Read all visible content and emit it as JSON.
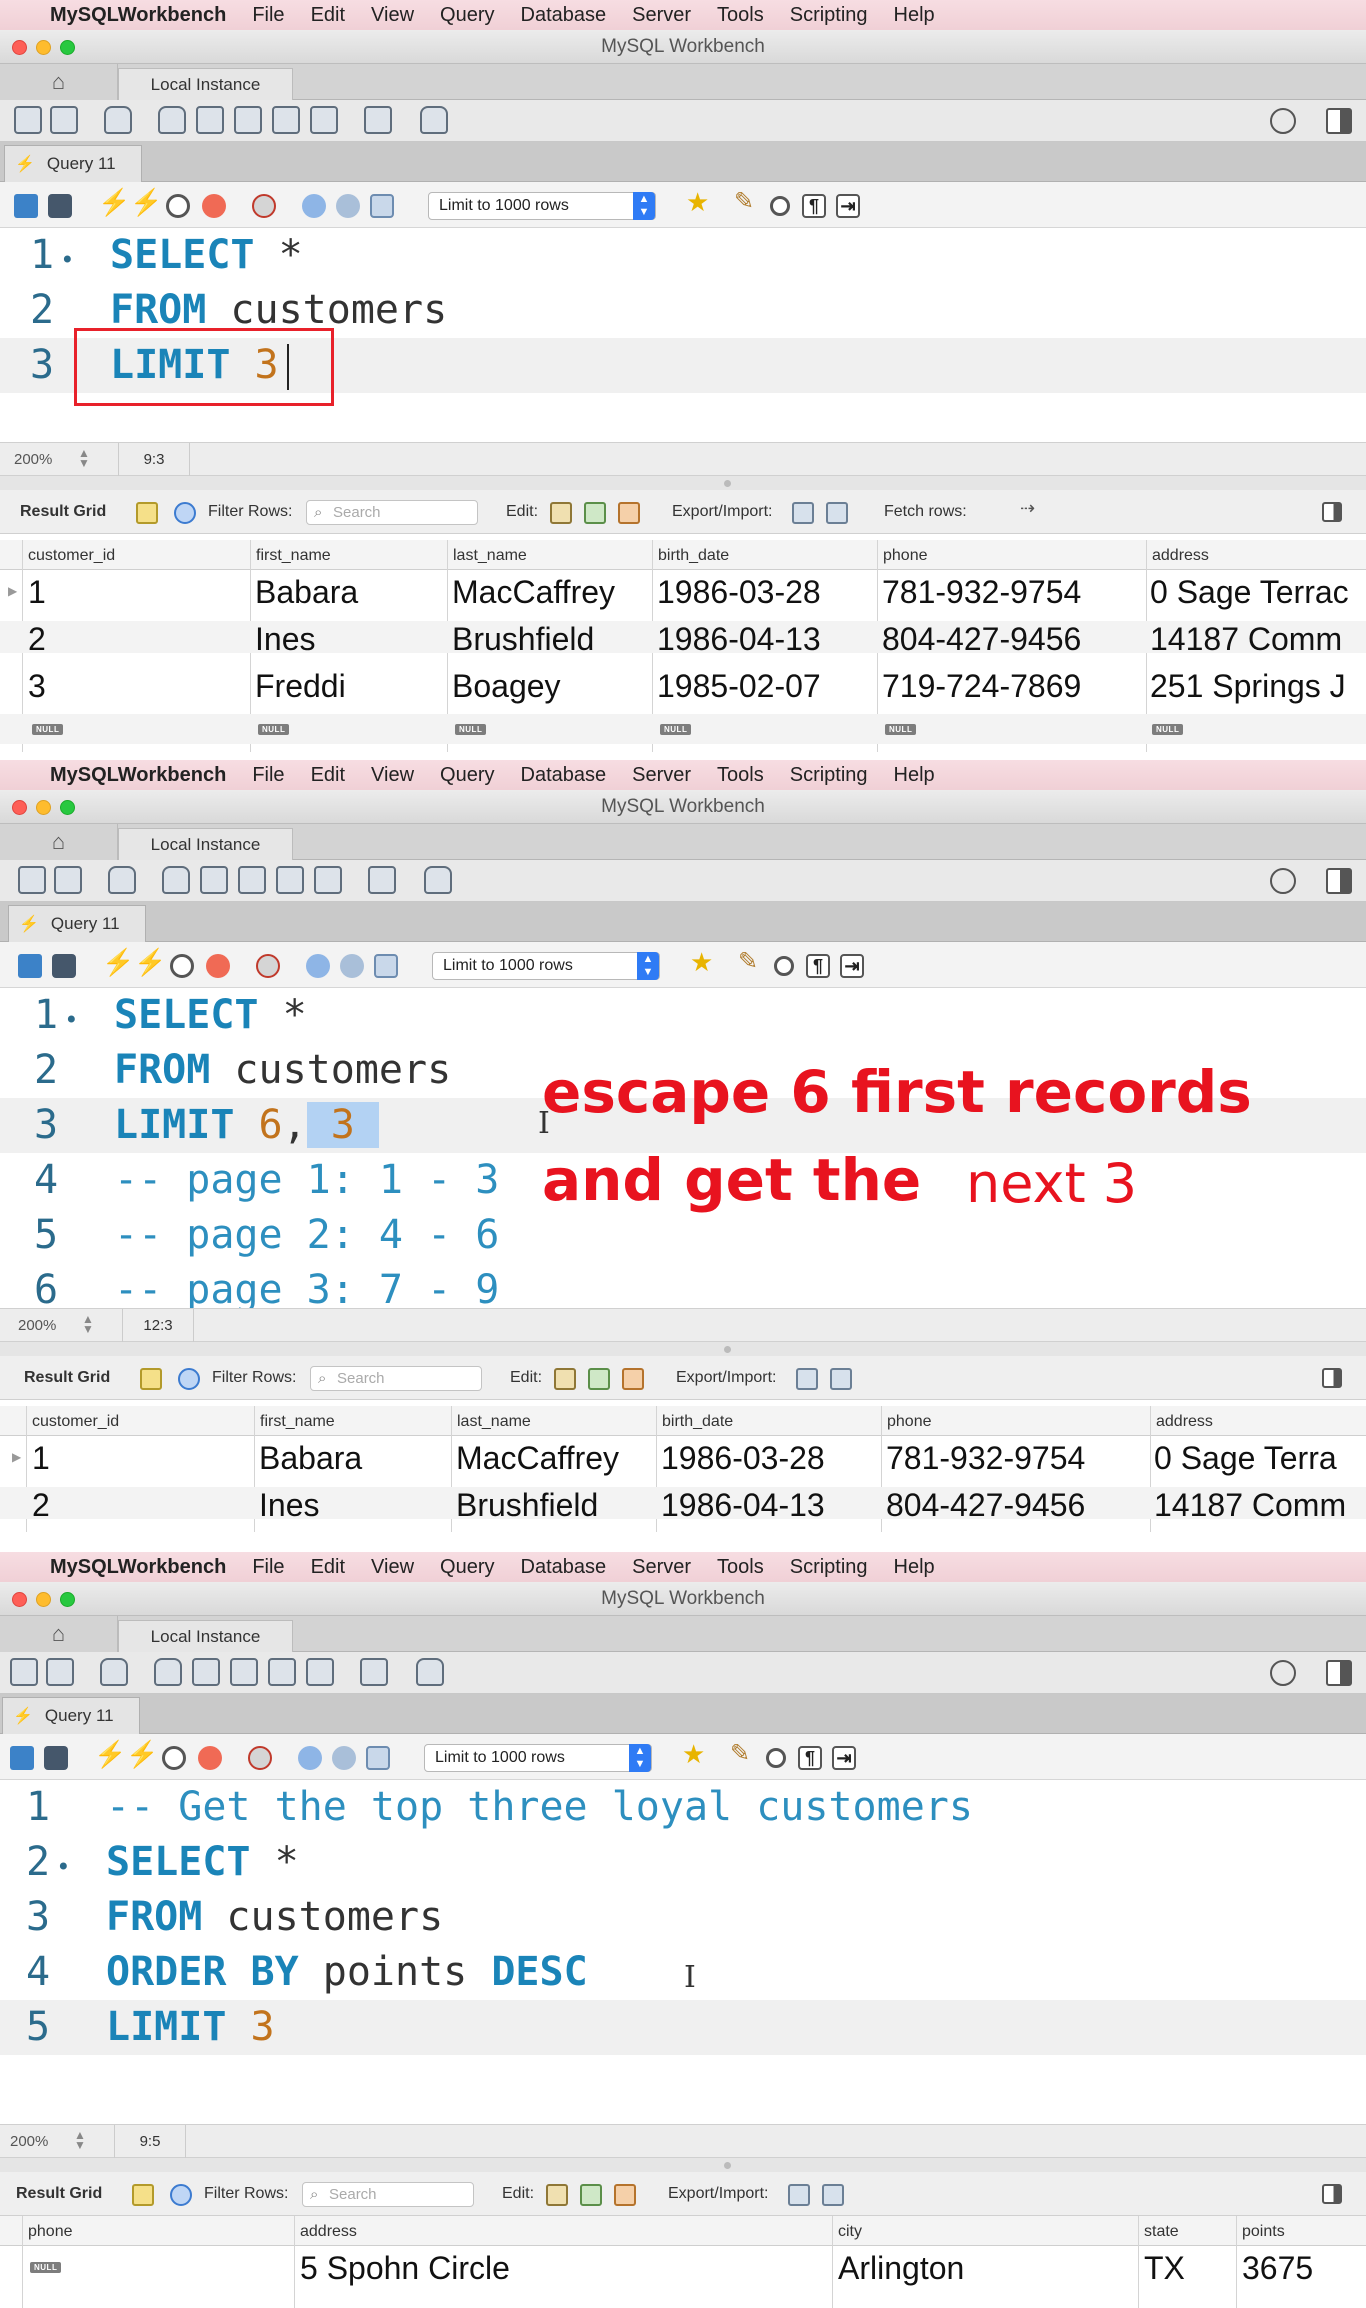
{
  "menubar": {
    "apple_icon": "",
    "app_name": "MySQLWorkbench",
    "items": [
      "File",
      "Edit",
      "View",
      "Query",
      "Database",
      "Server",
      "Tools",
      "Scripting",
      "Help"
    ]
  },
  "window": {
    "title": "MySQL Workbench",
    "connection_tab": "Local Instance",
    "query_tab": "Query 11"
  },
  "sql_toolbar": {
    "limit_select": "Limit to 1000 rows"
  },
  "result_toolbar": {
    "result_grid": "Result Grid",
    "filter_rows": "Filter Rows:",
    "search_placeholder": "Search",
    "edit": "Edit:",
    "export_import": "Export/Import:",
    "fetch_rows": "Fetch rows:"
  },
  "null_label": "NULL",
  "panel1": {
    "lines": [
      {
        "n": "1",
        "dot": "•"
      },
      {
        "n": "2",
        "dot": ""
      },
      {
        "n": "3",
        "dot": ""
      }
    ],
    "code": {
      "select": "SELECT",
      "star": "*",
      "from": "FROM",
      "table": "customers",
      "limit": "LIMIT",
      "limit_val": "3"
    },
    "status": {
      "zoom": "200%",
      "position": "9:3"
    },
    "columns": [
      "customer_id",
      "first_name",
      "last_name",
      "birth_date",
      "phone",
      "address"
    ],
    "rows": [
      [
        "1",
        "Babara",
        "MacCaffrey",
        "1986-03-28",
        "781-932-9754",
        "0 Sage Terrac"
      ],
      [
        "2",
        "Ines",
        "Brushfield",
        "1986-04-13",
        "804-427-9456",
        "14187 Comm"
      ],
      [
        "3",
        "Freddi",
        "Boagey",
        "1985-02-07",
        "719-724-7869",
        "251 Springs J"
      ]
    ]
  },
  "panel2": {
    "lines": [
      {
        "n": "1",
        "dot": "•"
      },
      {
        "n": "2",
        "dot": ""
      },
      {
        "n": "3",
        "dot": ""
      },
      {
        "n": "4",
        "dot": ""
      },
      {
        "n": "5",
        "dot": ""
      },
      {
        "n": "6",
        "dot": ""
      }
    ],
    "code": {
      "select": "SELECT",
      "star": "*",
      "from": "FROM",
      "table": "customers",
      "limit": "LIMIT",
      "offset": "6",
      "comma": ",",
      "count": "3",
      "c1": "-- page 1: 1 - 3",
      "c2": "-- page 2: 4 - 6",
      "c3": "-- page 3: 7 - 9"
    },
    "annotation": {
      "line1": "escape 6 first records",
      "line2a": "and get the",
      "line2b": "next 3"
    },
    "status": {
      "zoom": "200%",
      "position": "12:3"
    },
    "columns": [
      "customer_id",
      "first_name",
      "last_name",
      "birth_date",
      "phone",
      "address"
    ],
    "rows": [
      [
        "1",
        "Babara",
        "MacCaffrey",
        "1986-03-28",
        "781-932-9754",
        "0 Sage Terra"
      ],
      [
        "2",
        "Ines",
        "Brushfield",
        "1986-04-13",
        "804-427-9456",
        "14187 Comm"
      ]
    ]
  },
  "panel3": {
    "lines": [
      {
        "n": "1",
        "dot": ""
      },
      {
        "n": "2",
        "dot": "•"
      },
      {
        "n": "3",
        "dot": ""
      },
      {
        "n": "4",
        "dot": ""
      },
      {
        "n": "5",
        "dot": ""
      }
    ],
    "code": {
      "comment": "-- Get the top three loyal customers",
      "select": "SELECT",
      "star": "*",
      "from": "FROM",
      "table": "customers",
      "orderby": "ORDER BY",
      "col": "points",
      "desc": "DESC",
      "limit": "LIMIT",
      "limit_val": "3"
    },
    "status": {
      "zoom": "200%",
      "position": "9:5"
    },
    "columns": [
      "phone",
      "address",
      "city",
      "state",
      "points"
    ],
    "rows": [
      [
        "",
        "5 Spohn Circle",
        "Arlington",
        "TX",
        "3675"
      ]
    ]
  }
}
